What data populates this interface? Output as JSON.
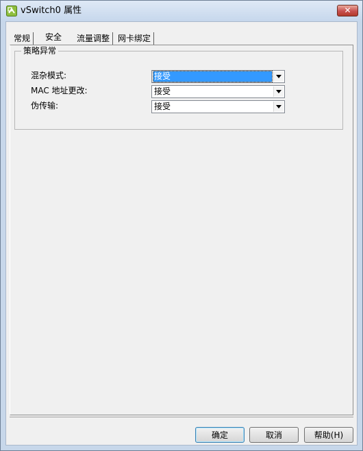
{
  "window": {
    "title": "vSwitch0 属性",
    "close_glyph": "✕"
  },
  "tabs": [
    {
      "label": "常规",
      "selected": false
    },
    {
      "label": "安全",
      "selected": true
    },
    {
      "label": "流量调整",
      "selected": false
    },
    {
      "label": "网卡绑定",
      "selected": false
    }
  ],
  "policy_group": {
    "title": "策略异常",
    "rows": [
      {
        "label": "混杂模式:",
        "value": "接受"
      },
      {
        "label": "MAC 地址更改:",
        "value": "接受"
      },
      {
        "label": "伪传输:",
        "value": "接受"
      }
    ]
  },
  "buttons": {
    "ok": "确定",
    "cancel": "取消",
    "help": "帮助(H)"
  },
  "icons": {
    "app": "vsphere-network-icon",
    "dropdown": "chevron-down-icon"
  },
  "colors": {
    "titlebar": "#c6d7ec",
    "dialog_bg": "#f0f0f0",
    "selection": "#3399ff",
    "close_button": "#c75050"
  }
}
